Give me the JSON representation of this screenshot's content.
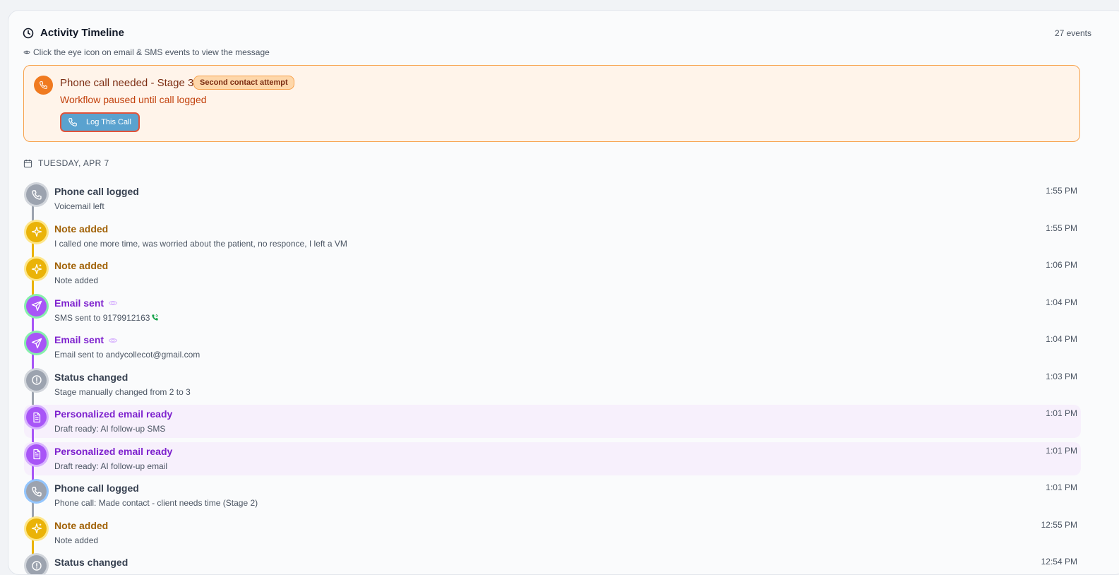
{
  "header": {
    "title": "Activity Timeline",
    "count": "27 events",
    "hint": "Click the eye icon on email & SMS events to view the message"
  },
  "alert": {
    "title": "Phone call needed - Stage 3",
    "badge": "Second contact attempt",
    "subtitle": "Workflow paused until call logged",
    "button_label": "Log This Call"
  },
  "date_group": "TUESDAY, APR 7",
  "events": [
    {
      "kind": "phone",
      "title": "Phone call logged",
      "desc": "Voicemail left",
      "time": "1:55 PM"
    },
    {
      "kind": "note",
      "title": "Note added",
      "desc": "I called one more time, was worried about the patient, no responce, I left a VM",
      "time": "1:55 PM"
    },
    {
      "kind": "note",
      "title": "Note added",
      "desc": "Note added",
      "time": "1:06 PM"
    },
    {
      "kind": "email",
      "title": "Email sent",
      "desc": "SMS sent to 9179912163",
      "time": "1:04 PM"
    },
    {
      "kind": "email",
      "title": "Email sent",
      "desc": "Email sent to andycollecot@gmail.com",
      "time": "1:04 PM"
    },
    {
      "kind": "status",
      "title": "Status changed",
      "desc": "Stage manually changed from 2 to 3",
      "time": "1:03 PM"
    },
    {
      "kind": "draft",
      "title": "Personalized email ready",
      "desc": "Draft ready: AI follow-up SMS",
      "time": "1:01 PM"
    },
    {
      "kind": "draft",
      "title": "Personalized email ready",
      "desc": "Draft ready: AI follow-up email",
      "time": "1:01 PM"
    },
    {
      "kind": "phone2",
      "title": "Phone call logged",
      "desc": "Phone call: Made contact - client needs time (Stage 2)",
      "time": "1:01 PM"
    },
    {
      "kind": "note",
      "title": "Note added",
      "desc": "Note added",
      "time": "12:55 PM"
    },
    {
      "kind": "status",
      "title": "Status changed",
      "desc": "",
      "time": "12:54 PM"
    }
  ],
  "colors": {
    "phone": "#9ca3af",
    "note": "#eab308",
    "email": "#a855f7",
    "status": "#9ca3af",
    "draft": "#a855f7",
    "alert_accent": "#f07a20",
    "button": "#5aa2cf"
  }
}
